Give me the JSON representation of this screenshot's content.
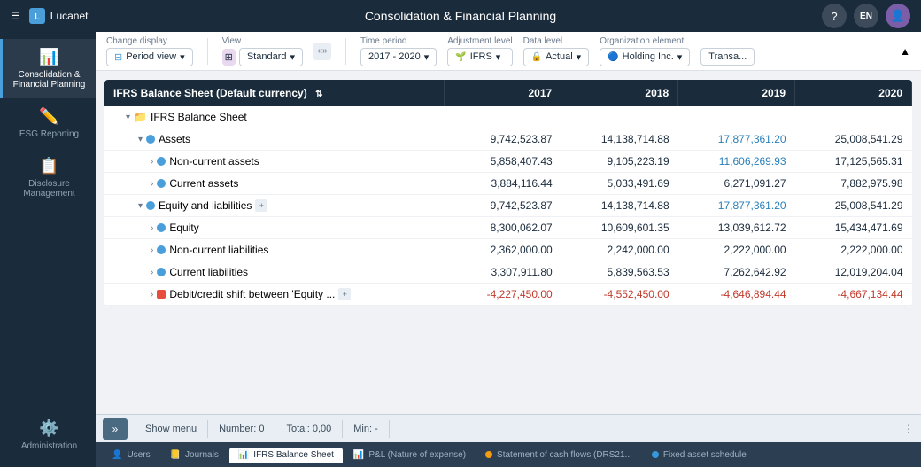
{
  "topbar": {
    "logo": "Lucanet",
    "title": "Consolidation & Financial Planning",
    "help_label": "?",
    "lang_label": "EN",
    "user_label": "U"
  },
  "sidebar": {
    "items": [
      {
        "id": "consolidation",
        "label": "Consolidation & Financial Planning",
        "icon": "📊",
        "active": true
      },
      {
        "id": "esg",
        "label": "ESG Reporting",
        "icon": "🌿",
        "active": false
      },
      {
        "id": "disclosure",
        "label": "Disclosure Management",
        "icon": "📋",
        "active": false
      },
      {
        "id": "admin",
        "label": "Administration",
        "icon": "⚙️",
        "active": false
      }
    ]
  },
  "toolbar": {
    "change_display_label": "Change display",
    "period_view_label": "Period view",
    "view_label": "View",
    "standard_label": "Standard",
    "time_period_label": "Time period",
    "time_period_value": "2017 - 2020",
    "adj_level_label": "Adjustment level",
    "adj_level_value": "IFRS",
    "data_level_label": "Data level",
    "data_level_value": "Actual",
    "org_element_label": "Organization element",
    "org_element_value": "Holding Inc.",
    "transactions_label": "Transa..."
  },
  "table": {
    "header_label": "IFRS Balance Sheet (Default currency)",
    "columns": [
      "2017",
      "2018",
      "2019",
      "2020"
    ],
    "rows": [
      {
        "type": "group-header",
        "indent": 1,
        "label": "IFRS Balance Sheet",
        "has_folder": true,
        "expanded": true
      },
      {
        "type": "data",
        "indent": 2,
        "dot": "blue",
        "label": "Assets",
        "expanded": true,
        "values": [
          "9,742,523.87",
          "14,138,714.88",
          "17,877,361.20",
          "25,008,541.29"
        ],
        "value_colors": [
          "normal",
          "normal",
          "blue",
          "normal"
        ]
      },
      {
        "type": "data",
        "indent": 3,
        "dot": "blue",
        "label": "Non-current assets",
        "collapsed": true,
        "values": [
          "5,858,407.43",
          "9,105,223.19",
          "11,606,269.93",
          "17,125,565.31"
        ],
        "value_colors": [
          "normal",
          "normal",
          "blue",
          "normal"
        ]
      },
      {
        "type": "data",
        "indent": 3,
        "dot": "blue",
        "label": "Current assets",
        "collapsed": true,
        "values": [
          "3,884,116.44",
          "5,033,491.69",
          "6,271,091.27",
          "7,882,975.98"
        ],
        "value_colors": [
          "normal",
          "normal",
          "normal",
          "normal"
        ]
      },
      {
        "type": "data",
        "indent": 2,
        "dot": "blue",
        "label": "Equity and liabilities",
        "expanded": true,
        "has_expand": true,
        "values": [
          "9,742,523.87",
          "14,138,714.88",
          "17,877,361.20",
          "25,008,541.29"
        ],
        "value_colors": [
          "normal",
          "normal",
          "blue",
          "normal"
        ]
      },
      {
        "type": "data",
        "indent": 3,
        "dot": "blue",
        "label": "Equity",
        "collapsed": true,
        "values": [
          "8,300,062.07",
          "10,609,601.35",
          "13,039,612.72",
          "15,434,471.69"
        ],
        "value_colors": [
          "normal",
          "normal",
          "normal",
          "normal"
        ]
      },
      {
        "type": "data",
        "indent": 3,
        "dot": "blue",
        "label": "Non-current liabilities",
        "collapsed": true,
        "values": [
          "2,362,000.00",
          "2,242,000.00",
          "2,222,000.00",
          "2,222,000.00"
        ],
        "value_colors": [
          "normal",
          "normal",
          "normal",
          "normal"
        ]
      },
      {
        "type": "data",
        "indent": 3,
        "dot": "blue",
        "label": "Current liabilities",
        "collapsed": true,
        "values": [
          "3,307,911.80",
          "5,839,563.53",
          "7,262,642.92",
          "12,019,204.04"
        ],
        "value_colors": [
          "normal",
          "normal",
          "normal",
          "normal"
        ]
      },
      {
        "type": "data",
        "indent": 3,
        "dot": "red",
        "label": "Debit/credit shift between 'Equity ...",
        "collapsed": true,
        "has_expand": true,
        "values": [
          "-4,227,450.00",
          "-4,552,450.00",
          "-4,646,894.44",
          "-4,667,134.44"
        ],
        "value_colors": [
          "negative",
          "negative",
          "negative",
          "negative"
        ]
      }
    ]
  },
  "statusbar": {
    "show_menu": "Show menu",
    "number_label": "Number:",
    "number_value": "0",
    "total_label": "Total:",
    "total_value": "0,00",
    "min_label": "Min:",
    "min_value": "-"
  },
  "bottom_tabs": [
    {
      "id": "users",
      "label": "Users",
      "icon": "person",
      "dot_color": null,
      "active": false
    },
    {
      "id": "journals",
      "label": "Journals",
      "icon": "journal",
      "dot_color": null,
      "active": false
    },
    {
      "id": "ifrs-balance",
      "label": "IFRS Balance Sheet",
      "icon": "table",
      "dot_color": null,
      "active": true
    },
    {
      "id": "pl-nature",
      "label": "P&L (Nature of expense)",
      "icon": "table",
      "dot_color": null,
      "active": false
    },
    {
      "id": "cashflow",
      "label": "Statement of cash flows (DRS21...",
      "icon": "dot",
      "dot_color": "#f39c12",
      "active": false
    },
    {
      "id": "fixed-asset",
      "label": "Fixed asset schedule",
      "icon": "dot",
      "dot_color": "#3498db",
      "active": false
    }
  ]
}
